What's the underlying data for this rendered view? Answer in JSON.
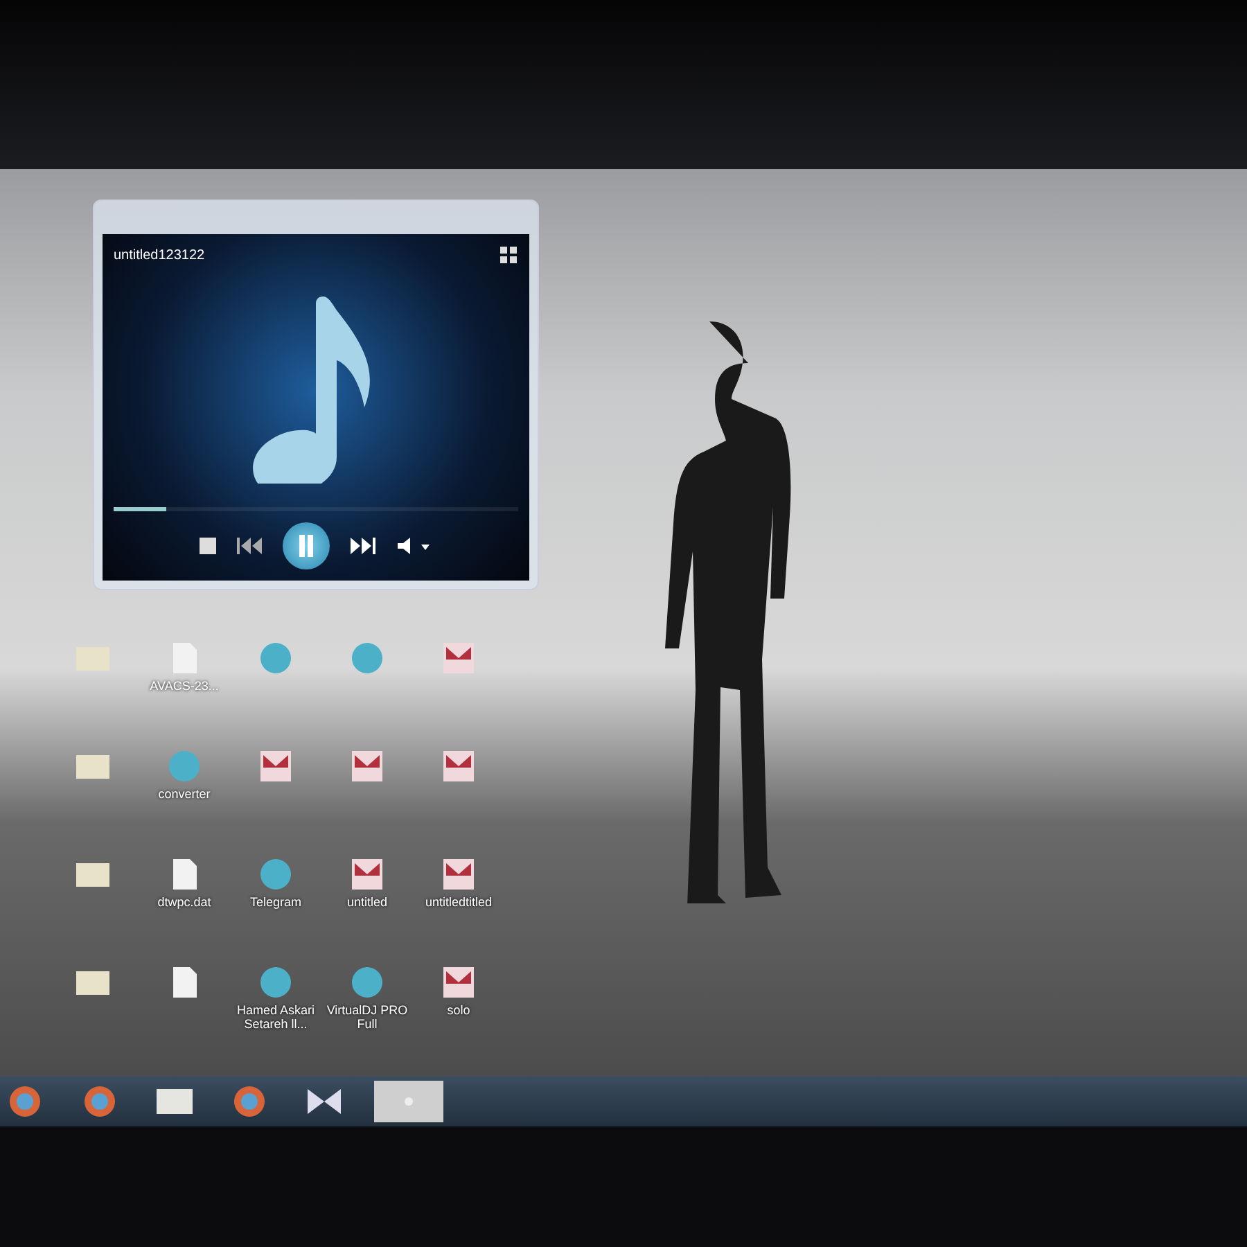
{
  "player": {
    "title": "untitled123122",
    "playing": true,
    "seek": {
      "level": 0.13
    }
  },
  "icon_rows": [
    [
      {
        "kind": "folder"
      },
      {
        "kind": "file",
        "label": "AVACS-23..."
      },
      {
        "kind": "app"
      },
      {
        "kind": "app"
      },
      {
        "kind": "mp3"
      }
    ],
    [
      {
        "kind": "folder"
      },
      {
        "kind": "app",
        "label": "converter"
      },
      {
        "kind": "mp3"
      },
      {
        "kind": "mp3"
      },
      {
        "kind": "mp3"
      }
    ],
    [
      {
        "kind": "folder"
      },
      {
        "kind": "file",
        "label": "dtwpc.dat"
      },
      {
        "kind": "app",
        "label": "Telegram"
      },
      {
        "kind": "mp3",
        "label": "untitled"
      },
      {
        "kind": "mp3",
        "label": "untitledtitled"
      }
    ],
    [
      {
        "kind": "folder"
      },
      {
        "kind": "file"
      },
      {
        "kind": "app",
        "label": "Hamed Askari Setareh ll..."
      },
      {
        "kind": "app",
        "label": "VirtualDJ PRO Full"
      },
      {
        "kind": "mp3",
        "label": "solo"
      }
    ]
  ],
  "taskbar": [
    {
      "kind": "browser",
      "selected": false
    },
    {
      "kind": "browser",
      "selected": false
    },
    {
      "kind": "folder",
      "selected": false
    },
    {
      "kind": "browser",
      "selected": false
    },
    {
      "kind": "media",
      "selected": false
    },
    {
      "kind": "window",
      "selected": true
    }
  ]
}
